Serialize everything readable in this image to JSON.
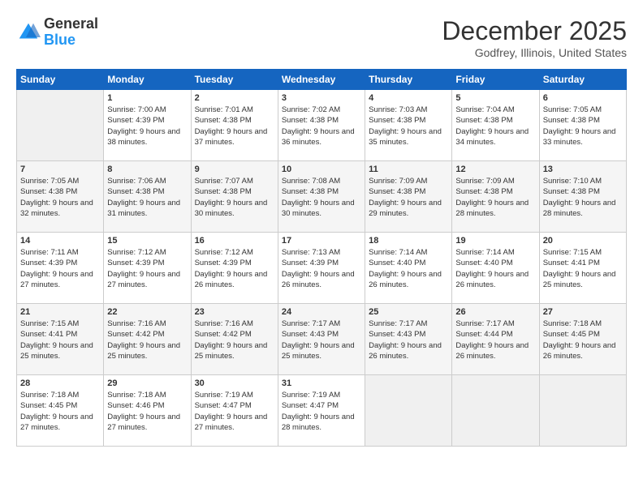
{
  "header": {
    "logo": {
      "line1": "General",
      "line2": "Blue"
    },
    "title": "December 2025",
    "location": "Godfrey, Illinois, United States"
  },
  "days_of_week": [
    "Sunday",
    "Monday",
    "Tuesday",
    "Wednesday",
    "Thursday",
    "Friday",
    "Saturday"
  ],
  "weeks": [
    [
      {
        "day": "",
        "sunrise": "",
        "sunset": "",
        "daylight": "",
        "empty": true
      },
      {
        "day": "1",
        "sunrise": "Sunrise: 7:00 AM",
        "sunset": "Sunset: 4:39 PM",
        "daylight": "Daylight: 9 hours and 38 minutes."
      },
      {
        "day": "2",
        "sunrise": "Sunrise: 7:01 AM",
        "sunset": "Sunset: 4:38 PM",
        "daylight": "Daylight: 9 hours and 37 minutes."
      },
      {
        "day": "3",
        "sunrise": "Sunrise: 7:02 AM",
        "sunset": "Sunset: 4:38 PM",
        "daylight": "Daylight: 9 hours and 36 minutes."
      },
      {
        "day": "4",
        "sunrise": "Sunrise: 7:03 AM",
        "sunset": "Sunset: 4:38 PM",
        "daylight": "Daylight: 9 hours and 35 minutes."
      },
      {
        "day": "5",
        "sunrise": "Sunrise: 7:04 AM",
        "sunset": "Sunset: 4:38 PM",
        "daylight": "Daylight: 9 hours and 34 minutes."
      },
      {
        "day": "6",
        "sunrise": "Sunrise: 7:05 AM",
        "sunset": "Sunset: 4:38 PM",
        "daylight": "Daylight: 9 hours and 33 minutes."
      }
    ],
    [
      {
        "day": "7",
        "sunrise": "Sunrise: 7:05 AM",
        "sunset": "Sunset: 4:38 PM",
        "daylight": "Daylight: 9 hours and 32 minutes."
      },
      {
        "day": "8",
        "sunrise": "Sunrise: 7:06 AM",
        "sunset": "Sunset: 4:38 PM",
        "daylight": "Daylight: 9 hours and 31 minutes."
      },
      {
        "day": "9",
        "sunrise": "Sunrise: 7:07 AM",
        "sunset": "Sunset: 4:38 PM",
        "daylight": "Daylight: 9 hours and 30 minutes."
      },
      {
        "day": "10",
        "sunrise": "Sunrise: 7:08 AM",
        "sunset": "Sunset: 4:38 PM",
        "daylight": "Daylight: 9 hours and 30 minutes."
      },
      {
        "day": "11",
        "sunrise": "Sunrise: 7:09 AM",
        "sunset": "Sunset: 4:38 PM",
        "daylight": "Daylight: 9 hours and 29 minutes."
      },
      {
        "day": "12",
        "sunrise": "Sunrise: 7:09 AM",
        "sunset": "Sunset: 4:38 PM",
        "daylight": "Daylight: 9 hours and 28 minutes."
      },
      {
        "day": "13",
        "sunrise": "Sunrise: 7:10 AM",
        "sunset": "Sunset: 4:38 PM",
        "daylight": "Daylight: 9 hours and 28 minutes."
      }
    ],
    [
      {
        "day": "14",
        "sunrise": "Sunrise: 7:11 AM",
        "sunset": "Sunset: 4:39 PM",
        "daylight": "Daylight: 9 hours and 27 minutes."
      },
      {
        "day": "15",
        "sunrise": "Sunrise: 7:12 AM",
        "sunset": "Sunset: 4:39 PM",
        "daylight": "Daylight: 9 hours and 27 minutes."
      },
      {
        "day": "16",
        "sunrise": "Sunrise: 7:12 AM",
        "sunset": "Sunset: 4:39 PM",
        "daylight": "Daylight: 9 hours and 26 minutes."
      },
      {
        "day": "17",
        "sunrise": "Sunrise: 7:13 AM",
        "sunset": "Sunset: 4:39 PM",
        "daylight": "Daylight: 9 hours and 26 minutes."
      },
      {
        "day": "18",
        "sunrise": "Sunrise: 7:14 AM",
        "sunset": "Sunset: 4:40 PM",
        "daylight": "Daylight: 9 hours and 26 minutes."
      },
      {
        "day": "19",
        "sunrise": "Sunrise: 7:14 AM",
        "sunset": "Sunset: 4:40 PM",
        "daylight": "Daylight: 9 hours and 26 minutes."
      },
      {
        "day": "20",
        "sunrise": "Sunrise: 7:15 AM",
        "sunset": "Sunset: 4:41 PM",
        "daylight": "Daylight: 9 hours and 25 minutes."
      }
    ],
    [
      {
        "day": "21",
        "sunrise": "Sunrise: 7:15 AM",
        "sunset": "Sunset: 4:41 PM",
        "daylight": "Daylight: 9 hours and 25 minutes."
      },
      {
        "day": "22",
        "sunrise": "Sunrise: 7:16 AM",
        "sunset": "Sunset: 4:42 PM",
        "daylight": "Daylight: 9 hours and 25 minutes."
      },
      {
        "day": "23",
        "sunrise": "Sunrise: 7:16 AM",
        "sunset": "Sunset: 4:42 PM",
        "daylight": "Daylight: 9 hours and 25 minutes."
      },
      {
        "day": "24",
        "sunrise": "Sunrise: 7:17 AM",
        "sunset": "Sunset: 4:43 PM",
        "daylight": "Daylight: 9 hours and 25 minutes."
      },
      {
        "day": "25",
        "sunrise": "Sunrise: 7:17 AM",
        "sunset": "Sunset: 4:43 PM",
        "daylight": "Daylight: 9 hours and 26 minutes."
      },
      {
        "day": "26",
        "sunrise": "Sunrise: 7:17 AM",
        "sunset": "Sunset: 4:44 PM",
        "daylight": "Daylight: 9 hours and 26 minutes."
      },
      {
        "day": "27",
        "sunrise": "Sunrise: 7:18 AM",
        "sunset": "Sunset: 4:45 PM",
        "daylight": "Daylight: 9 hours and 26 minutes."
      }
    ],
    [
      {
        "day": "28",
        "sunrise": "Sunrise: 7:18 AM",
        "sunset": "Sunset: 4:45 PM",
        "daylight": "Daylight: 9 hours and 27 minutes."
      },
      {
        "day": "29",
        "sunrise": "Sunrise: 7:18 AM",
        "sunset": "Sunset: 4:46 PM",
        "daylight": "Daylight: 9 hours and 27 minutes."
      },
      {
        "day": "30",
        "sunrise": "Sunrise: 7:19 AM",
        "sunset": "Sunset: 4:47 PM",
        "daylight": "Daylight: 9 hours and 27 minutes."
      },
      {
        "day": "31",
        "sunrise": "Sunrise: 7:19 AM",
        "sunset": "Sunset: 4:47 PM",
        "daylight": "Daylight: 9 hours and 28 minutes."
      },
      {
        "day": "",
        "sunrise": "",
        "sunset": "",
        "daylight": "",
        "empty": true
      },
      {
        "day": "",
        "sunrise": "",
        "sunset": "",
        "daylight": "",
        "empty": true
      },
      {
        "day": "",
        "sunrise": "",
        "sunset": "",
        "daylight": "",
        "empty": true
      }
    ]
  ]
}
